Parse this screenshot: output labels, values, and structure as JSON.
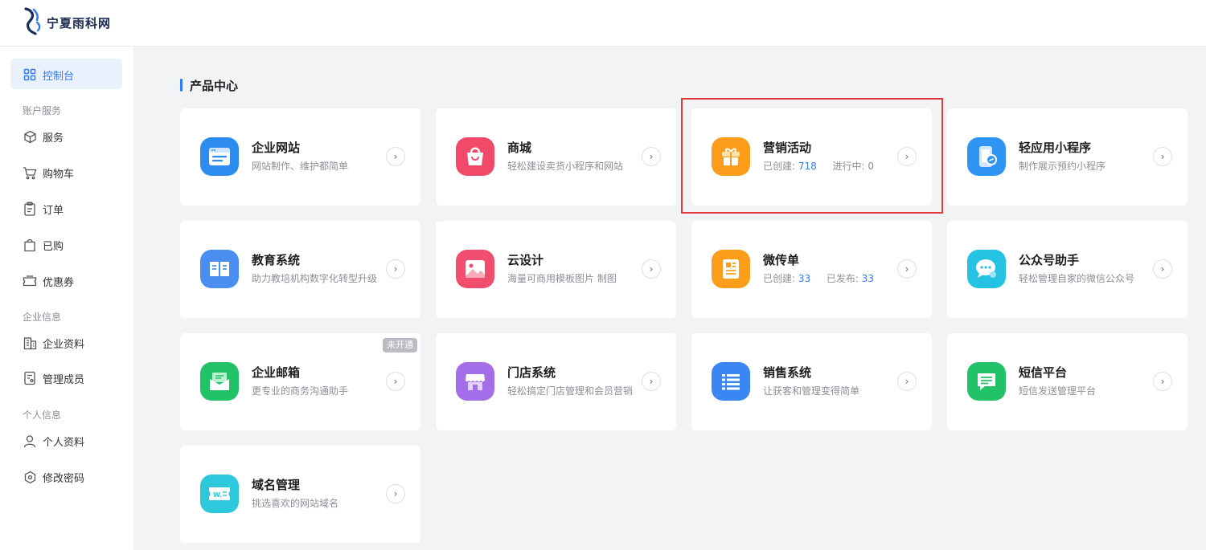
{
  "header": {
    "logo_text": "宁夏雨科网"
  },
  "sidebar": {
    "console": "控制台",
    "groups": {
      "account": "账户服务",
      "enterprise": "企业信息",
      "personal": "个人信息"
    },
    "items": {
      "service": "服务",
      "cart": "购物车",
      "orders": "订单",
      "purchased": "已购",
      "coupons": "优惠券",
      "company_info": "企业资料",
      "members": "管理成员",
      "profile": "个人资料",
      "password": "修改密码"
    }
  },
  "main": {
    "section_title": "产品中心",
    "cards": {
      "website": {
        "title": "企业网站",
        "desc": "网站制作、维护都简单"
      },
      "mall": {
        "title": "商城",
        "desc": "轻松建设卖货小程序和网站"
      },
      "marketing": {
        "title": "营销活动",
        "created_label": "已创建:",
        "created_value": "718",
        "ongoing_label": "进行中:",
        "ongoing_value": "0"
      },
      "miniapp": {
        "title": "轻应用小程序",
        "desc": "制作展示预约小程序"
      },
      "education": {
        "title": "教育系统",
        "desc": "助力教培机构数字化转型升级"
      },
      "design": {
        "title": "云设计",
        "desc": "海量可商用模板图片 制图"
      },
      "flyer": {
        "title": "微传单",
        "created_label": "已创建:",
        "created_value": "33",
        "published_label": "已发布:",
        "published_value": "33"
      },
      "wechat": {
        "title": "公众号助手",
        "desc": "轻松管理自家的微信公众号"
      },
      "email": {
        "title": "企业邮箱",
        "desc": "更专业的商务沟通助手",
        "badge": "未开通"
      },
      "store": {
        "title": "门店系统",
        "desc": "轻松搞定门店管理和会员营销"
      },
      "sales": {
        "title": "销售系统",
        "desc": "让获客和管理变得简单"
      },
      "sms": {
        "title": "短信平台",
        "desc": "短信发送管理平台"
      },
      "domain": {
        "title": "域名管理",
        "desc": "挑选喜欢的网站域名"
      }
    }
  },
  "colors": {
    "accent": "#2f7cf6",
    "highlight": "#e23a3a",
    "website": "#2d8cf0",
    "mall": "#f2496b",
    "marketing": "#fb9d1a",
    "miniapp": "#2f95f5",
    "education": "#4a8ff0",
    "design": "#f14d6f",
    "flyer": "#fb9d1a",
    "wechat": "#26c2e3",
    "email": "#22c268",
    "store": "#a46ee8",
    "sales": "#3a86f2",
    "sms": "#22c268",
    "domain": "#2ec8dc"
  }
}
